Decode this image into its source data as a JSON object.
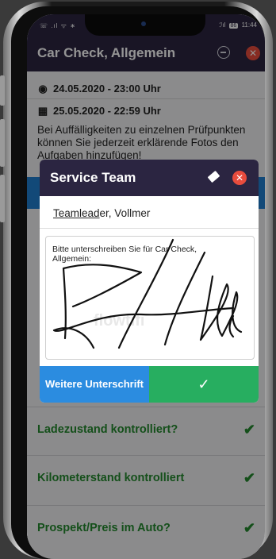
{
  "status_bar": {
    "left": "☏ .ıl ᯤ ∗",
    "right_signal": "ℐıl",
    "battery": "86",
    "time": "11:44"
  },
  "header": {
    "title": "Car Check, Allgemein"
  },
  "info": {
    "start_icon": "◉",
    "start_date": "24.05.2020 - 23:00 Uhr",
    "end_icon": "▦",
    "end_date": "25.05.2020 - 22:59 Uhr",
    "note": "Bei Auffälligkeiten zu einzelnen Prüfpunkten können Sie jederzeit erklärende Fotos den Aufgaben hinzufügen!"
  },
  "dialog": {
    "title": "Service Team",
    "name_underlined": "Teamlead",
    "name_rest": "er, Vollmer",
    "sign_prompt": "Bitte unterschreiben Sie für Car Check, Allgemein:",
    "watermark": "flowtifi",
    "more_button": "Weitere Unterschrift",
    "ok_button": "✓"
  },
  "checklist": [
    {
      "label": "Ladezustand kontrolliert?",
      "check": "✔"
    },
    {
      "label": "Kilometerstand kontrolliert",
      "check": "✔"
    },
    {
      "label": "Prospekt/Preis im Auto?",
      "check": "✔"
    }
  ],
  "colors": {
    "header": "#2b2541",
    "accent_green": "#23892d",
    "blue": "#2b8ce0",
    "ok_green": "#27ae60",
    "close_red": "#e84c3d"
  }
}
